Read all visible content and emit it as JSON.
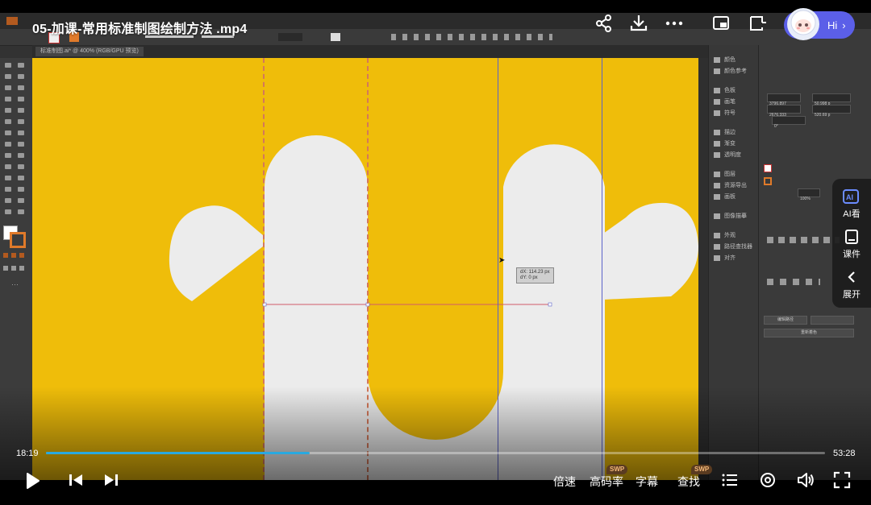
{
  "video": {
    "title": "05-加课-常用标准制图绘制方法 .mp4",
    "current_time": "18:19",
    "total_time": "53:28",
    "progress_fraction": 0.339
  },
  "top_actions": {
    "share_icon": "share-icon",
    "download_icon": "download-icon",
    "more_icon": "more-icon",
    "hi_label": "Hi"
  },
  "side_panel": {
    "ai_label": "AI看",
    "courseware_label": "课件",
    "expand_label": "展开"
  },
  "controls": {
    "speed_label": "倍速",
    "quality_label": "高码率",
    "quality_badge": "SWP",
    "subtitle_label": "字幕",
    "search_label": "查找",
    "search_badge": "SWP"
  },
  "illustrator": {
    "doc_tab": "标准制图.ai* @ 400% (RGB/GPU 预览)",
    "measure_dx": "dX: 114.23 px",
    "measure_dy": "dY: 0 px",
    "panel_items": [
      "颜色",
      "颜色参考",
      "色板",
      "画笔",
      "符号",
      "描边",
      "渐变",
      "透明度",
      "图层",
      "资源导出",
      "画板",
      "图像描摹",
      "外观",
      "路径查找器",
      "对齐"
    ],
    "transform_x": "3796.897",
    "transform_y": "2676.333",
    "transform_w": "50.998 p",
    "transform_h": "520.69 p",
    "angle": "0°",
    "opacity": "100%",
    "align_button_1": "编辑路径",
    "align_button_2": "重新着色"
  },
  "colors": {
    "artboard": "#efbd0a",
    "shape": "#ececec",
    "progress": "#29a9e0",
    "accent_pill": "#5b5fe8"
  }
}
